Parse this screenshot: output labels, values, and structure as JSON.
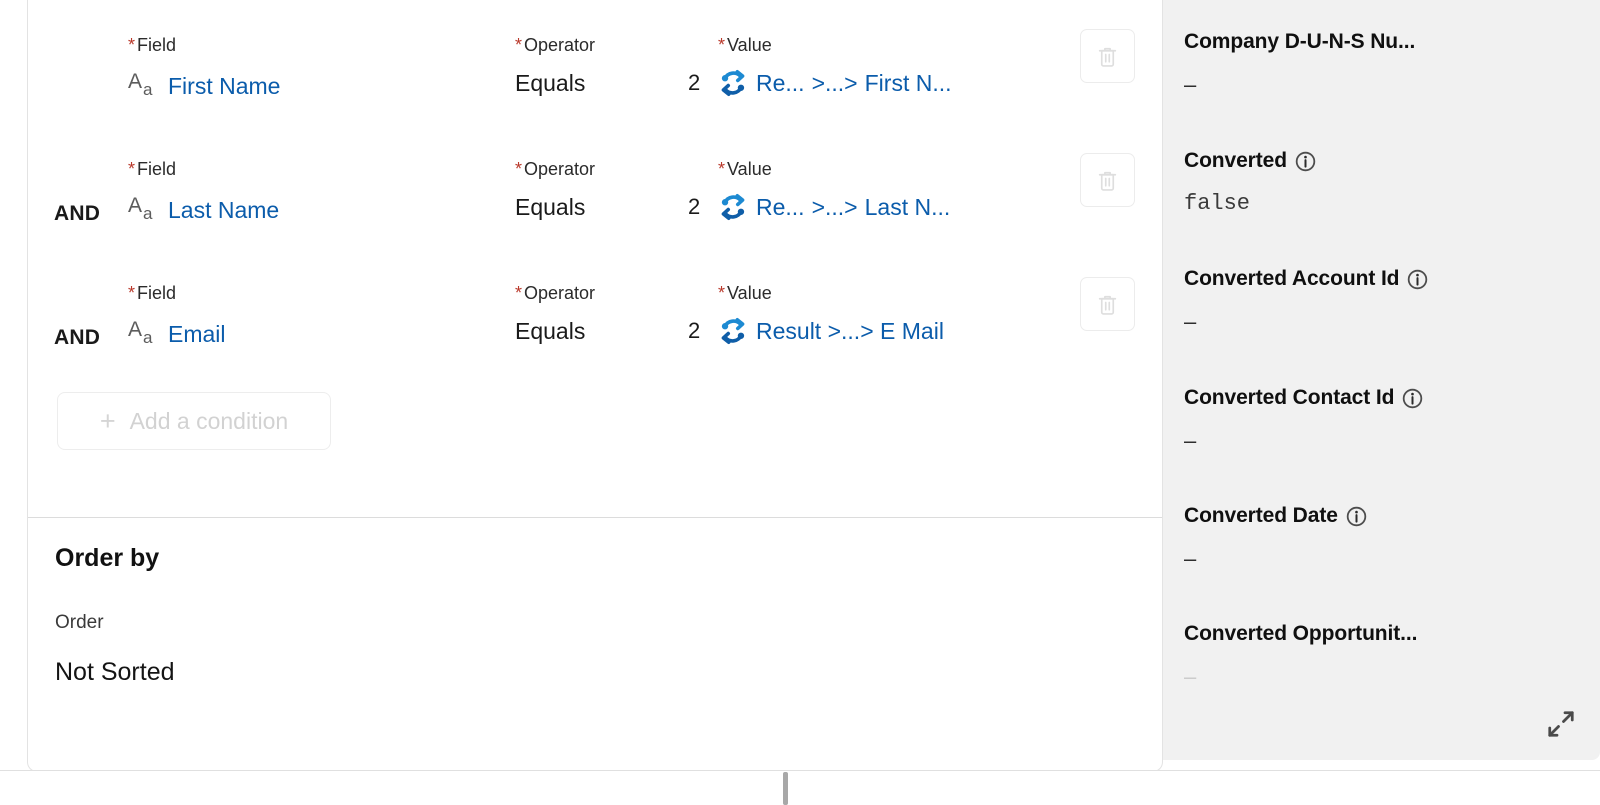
{
  "builder": {
    "conditions": [
      {
        "logic": "",
        "field_label": "Field",
        "field_icon": "text-field-icon",
        "field_value": "First Name",
        "operator_label": "Operator",
        "operator_value": "Equals",
        "value_label": "Value",
        "value_count": "2",
        "value_icon": "merge-sync-icon",
        "value_ref_prefix": "Re...",
        "value_ref_separator": ">...>",
        "value_ref_suffix": "First N..."
      },
      {
        "logic": "AND",
        "field_label": "Field",
        "field_icon": "text-field-icon",
        "field_value": "Last Name",
        "operator_label": "Operator",
        "operator_value": "Equals",
        "value_label": "Value",
        "value_count": "2",
        "value_icon": "merge-sync-icon",
        "value_ref_prefix": "Re...",
        "value_ref_separator": ">...>",
        "value_ref_suffix": "Last N..."
      },
      {
        "logic": "AND",
        "field_label": "Field",
        "field_icon": "text-field-icon",
        "field_value": "Email",
        "operator_label": "Operator",
        "operator_value": "Equals",
        "value_label": "Value",
        "value_count": "2",
        "value_icon": "merge-sync-icon",
        "value_ref_prefix": "Result",
        "value_ref_separator": ">...>",
        "value_ref_suffix": "E Mail"
      }
    ],
    "required_marker": "*",
    "delete_icon": "trash-icon",
    "add_condition": {
      "icon": "plus-icon",
      "label": "Add a condition"
    },
    "order_by": {
      "title": "Order by",
      "sublabel": "Order",
      "value": "Not Sorted"
    }
  },
  "detail_panel": {
    "expand_icon": "expand-diagonal-icon",
    "items": [
      {
        "name": "Company D-U-N-S Nu...",
        "has_info": false,
        "value": "–",
        "value_style": "dash"
      },
      {
        "name": "Converted",
        "has_info": true,
        "value": "false",
        "value_style": "mono"
      },
      {
        "name": "Converted Account Id",
        "has_info": true,
        "value": "–",
        "value_style": "dash"
      },
      {
        "name": "Converted Contact Id",
        "has_info": true,
        "value": "–",
        "value_style": "dash"
      },
      {
        "name": "Converted Date",
        "has_info": true,
        "value": "–",
        "value_style": "dash"
      },
      {
        "name": "Converted Opportunit...",
        "has_info": false,
        "value": "–",
        "value_style": "faded"
      }
    ]
  },
  "colors": {
    "link_blue": "#0b5cab",
    "required_red": "#b9392b",
    "panel_bg": "#f1f1f1",
    "merge_icon_blue": "#1d8ad2",
    "merge_icon_dark_blue": "#0f5ea8"
  }
}
